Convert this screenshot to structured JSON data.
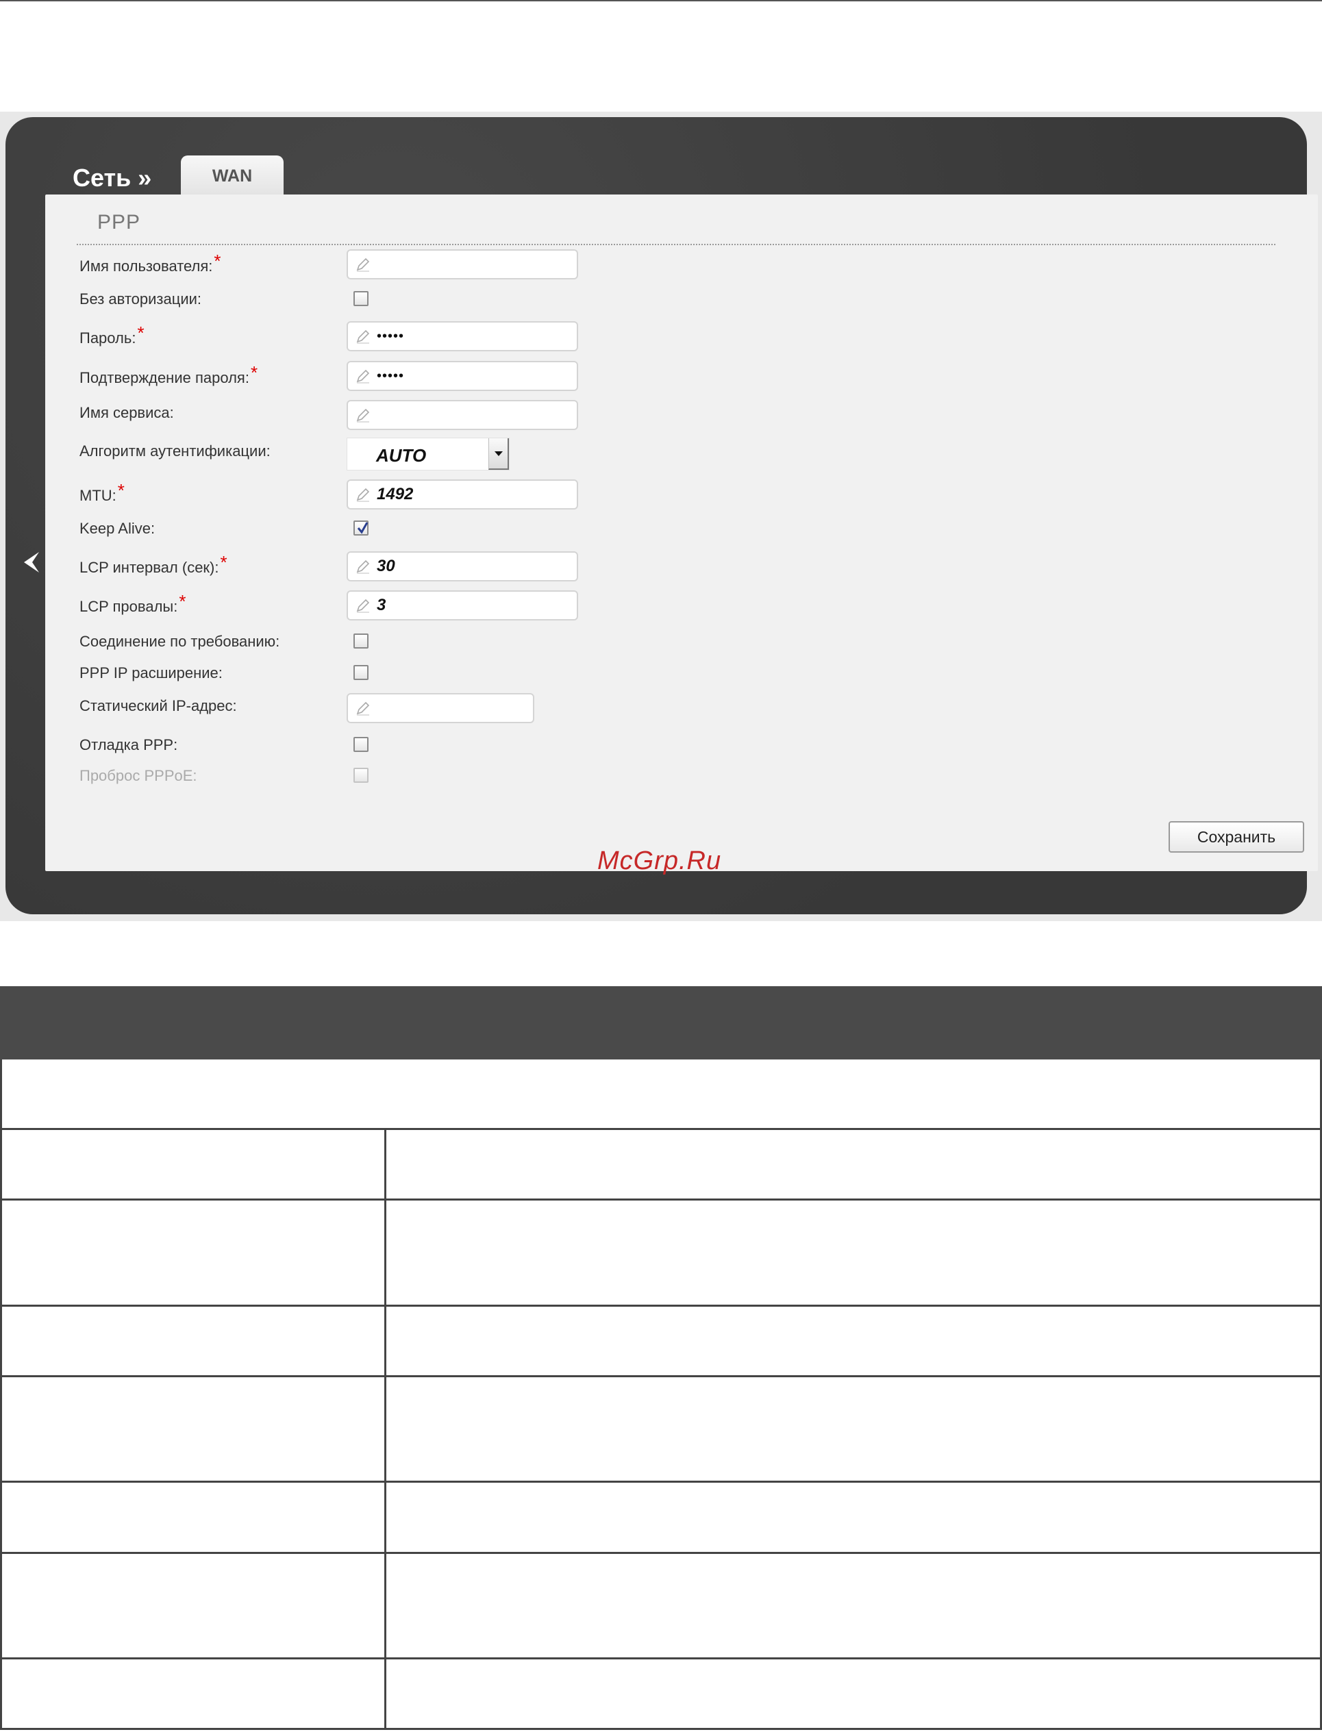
{
  "breadcrumb": {
    "section": "Сеть »",
    "active_tab": "WAN"
  },
  "form": {
    "section_title": "PPP",
    "fields": {
      "username": {
        "label": "Имя пользователя:",
        "required": "*",
        "value": ""
      },
      "no_auth": {
        "label": "Без авторизации:",
        "checked": false
      },
      "password": {
        "label": "Пароль:",
        "required": "*",
        "value": "•••••"
      },
      "password_confirm": {
        "label": "Подтверждение пароля:",
        "required": "*",
        "value": "•••••"
      },
      "service_name": {
        "label": "Имя сервиса:",
        "value": ""
      },
      "auth_algorithm": {
        "label": "Алгоритм аутентификации:",
        "value": "AUTO"
      },
      "mtu": {
        "label": "MTU:",
        "required": "*",
        "value": "1492"
      },
      "keep_alive": {
        "label": "Keep Alive:",
        "checked": true
      },
      "lcp_interval": {
        "label": "LCP интервал (сек):",
        "required": "*",
        "value": "30"
      },
      "lcp_failures": {
        "label": "LCP провалы:",
        "required": "*",
        "value": "3"
      },
      "dial_on_demand": {
        "label": "Соединение по требованию:",
        "checked": false
      },
      "ppp_ip_ext": {
        "label": "PPP IP расширение:",
        "checked": false
      },
      "static_ip": {
        "label": "Статический IP-адрес:",
        "value": ""
      },
      "ppp_debug": {
        "label": "Отладка PPP:",
        "checked": false
      },
      "pppoe_passthrough": {
        "label": "Проброс PPPoE:",
        "checked": false
      }
    },
    "save_label": "Сохранить"
  },
  "watermark": "McGrp.Ru",
  "colors": {
    "frame": "#3e3e3e",
    "panel": "#f1f1f1",
    "required": "#dd0000",
    "table_header": "#4a4a4a"
  }
}
